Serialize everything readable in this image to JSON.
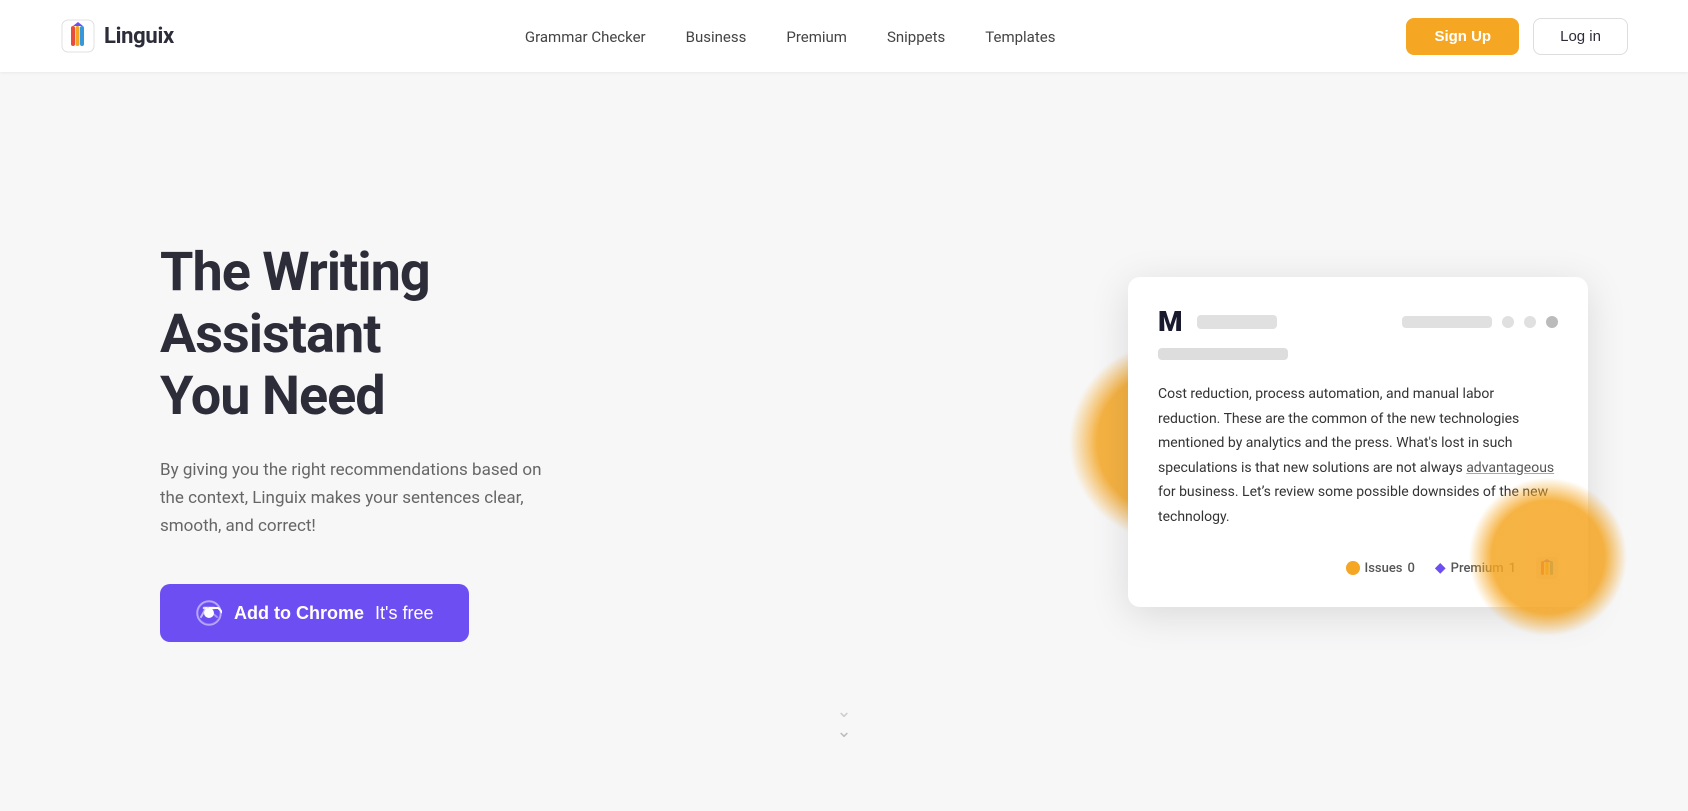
{
  "nav": {
    "logo_text": "Linguix",
    "links": [
      {
        "label": "Grammar Checker",
        "id": "grammar-checker"
      },
      {
        "label": "Business",
        "id": "business"
      },
      {
        "label": "Premium",
        "id": "premium"
      },
      {
        "label": "Snippets",
        "id": "snippets"
      },
      {
        "label": "Templates",
        "id": "templates"
      }
    ],
    "signup_label": "Sign Up",
    "login_label": "Log in"
  },
  "hero": {
    "title_line1": "The Writing Assistant",
    "title_line2": "You Need",
    "subtitle": "By giving you the right recommendations based on the context, Linguix makes your sentences clear, smooth, and correct!",
    "cta_label": "Add to Chrome",
    "cta_sublabel": "It's free"
  },
  "card": {
    "bold_letter": "M",
    "body_text": "Cost reduction, process automation, and manual labor reduction. These are the common of the new technologies mentioned by analytics and the press. What's lost in such speculations is that new solutions are not always ",
    "linked_word": "advantageous",
    "body_text2": " for business. Let’s review some possible downsides of the new technology.",
    "issues_label": "Issues",
    "issues_count": "0",
    "premium_label": "Premium",
    "premium_count": "1"
  },
  "scroll": {
    "arrow_char": "‹",
    "chevron1": "⌄",
    "chevron2": "⌄"
  }
}
